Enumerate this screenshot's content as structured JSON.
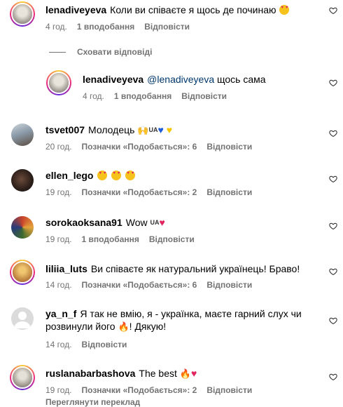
{
  "comments": [
    {
      "username": "lenadiveyeva",
      "text": "Коли ви співаєте я щось де починаю",
      "time": "4 год.",
      "likes": "1 вподобання",
      "reply": "Відповісти",
      "avatar_color": "#c9c4bc"
    },
    {
      "username": "lenadiveyeva",
      "mention": "@lenadiveyeva",
      "text": "щось сама",
      "time": "4 год.",
      "likes": "1 вподобання",
      "reply": "Відповісти",
      "avatar_color": "#c9c4bc"
    },
    {
      "username": "tsvet007",
      "text": "Молодець",
      "flag": "UA",
      "time": "20 год.",
      "likes": "Позначки «Подобається»: 6",
      "reply": "Відповісти",
      "avatar_color": "#7a8fa0"
    },
    {
      "username": "ellen_lego",
      "text": "",
      "time": "19 год.",
      "likes": "Позначки «Подобається»: 2",
      "reply": "Відповісти",
      "avatar_color": "#3a2a24"
    },
    {
      "username": "sorokaoksana91",
      "text": "Wow",
      "flag": "UA",
      "time": "19 год.",
      "likes": "1 вподобання",
      "reply": "Відповісти",
      "avatar_color": "#b8572f"
    },
    {
      "username": "liliia_luts",
      "text": "Ви співаєте як натуральний українець! Браво!",
      "time": "14 год.",
      "likes": "Позначки «Подобається»: 6",
      "reply": "Відповісти",
      "avatar_color": "#d4a24c"
    },
    {
      "username": "ya_n_f",
      "text": "Я так не вмію, я - українка, маєте гарний слух чи розвинули його",
      "text_end": "! Дякую!",
      "time": "14 год.",
      "reply": "Відповісти",
      "avatar_color": "#dbdbdb"
    },
    {
      "username": "ruslanabarbashova",
      "text": "The best",
      "time": "19 год.",
      "likes": "Позначки «Подобається»: 2",
      "reply": "Відповісти",
      "avatar_color": "#a8a39a"
    }
  ],
  "hide_replies": "Сховати відповіді",
  "see_translation": "Переглянути переклад",
  "colors": {
    "meta_gray": "#737373",
    "mention_blue": "#00376b",
    "ring_gradient": [
      "#f9ce34",
      "#ee2a7b",
      "#6228d7"
    ]
  },
  "icons": [
    "heart-outline-icon",
    "heart-eyes-emoji",
    "raising-hands-emoji",
    "blue-heart-emoji",
    "yellow-heart-emoji",
    "red-heart-emoji",
    "fire-emoji",
    "default-avatar-icon"
  ]
}
